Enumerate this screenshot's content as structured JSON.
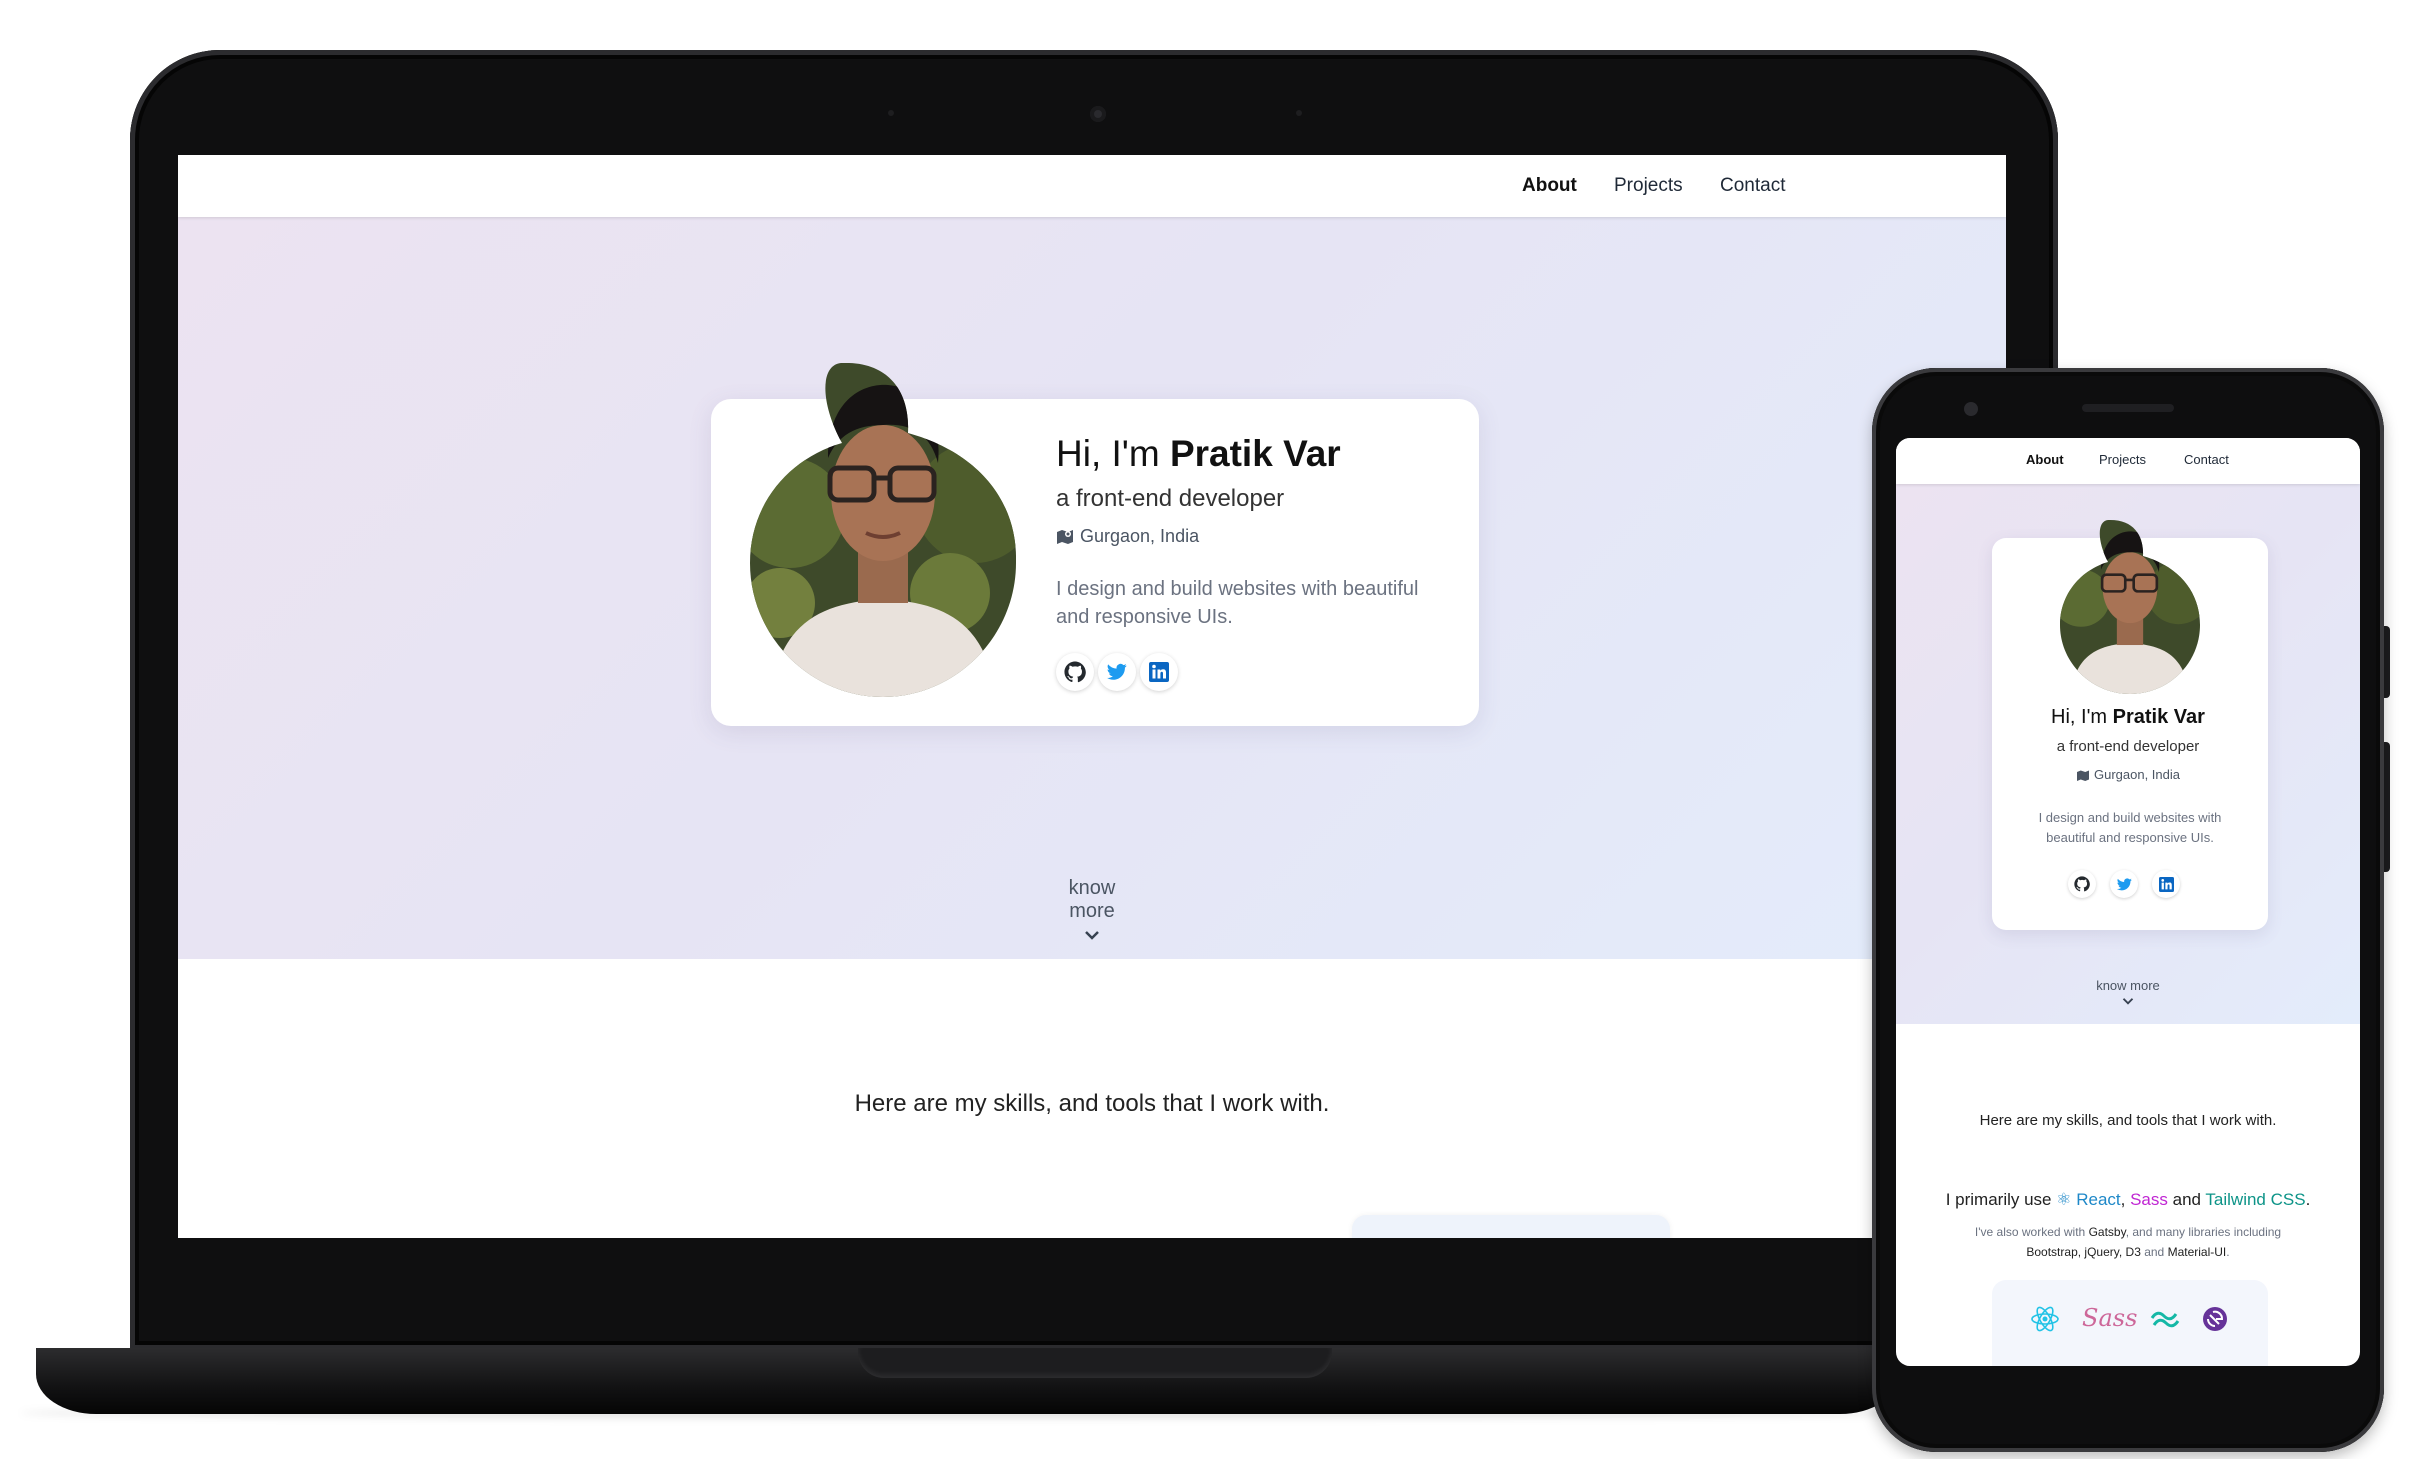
{
  "nav": {
    "about": "About",
    "projects": "Projects",
    "contact": "Contact"
  },
  "hero": {
    "greeting": "Hi, I'm ",
    "name": "Pratik Var",
    "role": "a front-end developer",
    "location": "Gurgaon, India",
    "bio": "I design and build websites with beautiful and responsive UIs.",
    "social": [
      "github-icon",
      "twitter-icon",
      "linkedin-icon"
    ]
  },
  "know_more": "know more",
  "skills": {
    "heading": "Here are my skills, and tools that I work with.",
    "primary_prefix": "I primarily use ",
    "react": "React",
    "sep1": ", ",
    "sass": "Sass",
    "and": " and ",
    "tailwind": "Tailwind CSS",
    "period": ".",
    "also_prefix": "I've also worked with ",
    "gatsby": "Gatsby",
    "also_mid": ", and many libraries including",
    "libs": "Bootstrap, jQuery, D3",
    "and2": " and ",
    "mui": "Material-UI",
    "period2": "."
  },
  "colors": {
    "react": "#1e88c8",
    "sass": "#c026d3",
    "tailwind": "#0d9488",
    "accent": "#2563eb"
  }
}
